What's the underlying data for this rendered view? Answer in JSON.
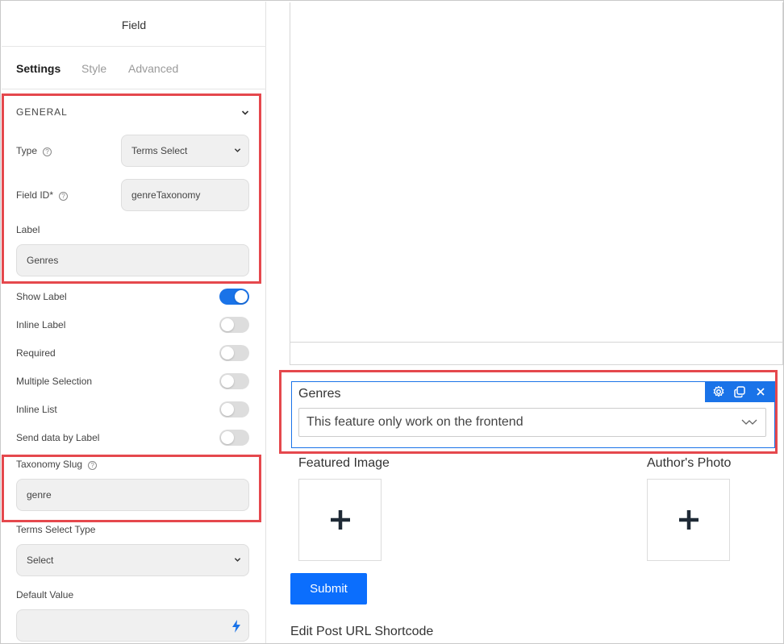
{
  "panel": {
    "title": "Field",
    "tabs": [
      "Settings",
      "Style",
      "Advanced"
    ],
    "section": "GENERAL",
    "type_label": "Type",
    "type_value": "Terms Select",
    "field_id_label": "Field ID*",
    "field_id_value": "genreTaxonomy",
    "label_label": "Label",
    "label_value": "Genres",
    "toggles": [
      {
        "label": "Show Label",
        "on": true
      },
      {
        "label": "Inline Label",
        "on": false
      },
      {
        "label": "Required",
        "on": false
      },
      {
        "label": "Multiple Selection",
        "on": false
      },
      {
        "label": "Inline List",
        "on": false
      },
      {
        "label": "Send data by Label",
        "on": false
      }
    ],
    "taxonomy_slug_label": "Taxonomy Slug",
    "taxonomy_slug_value": "genre",
    "terms_select_type_label": "Terms Select Type",
    "terms_select_type_value": "Select",
    "default_value_label": "Default Value",
    "help_glyph": "?"
  },
  "form": {
    "genres_label": "Genres",
    "genres_select_text": "This feature only work on the frontend",
    "featured_image_label": "Featured Image",
    "authors_photo_label": "Author's Photo",
    "submit_label": "Submit",
    "edit_post_label": "Edit Post URL Shortcode"
  },
  "colors": {
    "accent": "#1a73e8",
    "highlight": "#e5484d",
    "submit": "#0b6efd"
  }
}
